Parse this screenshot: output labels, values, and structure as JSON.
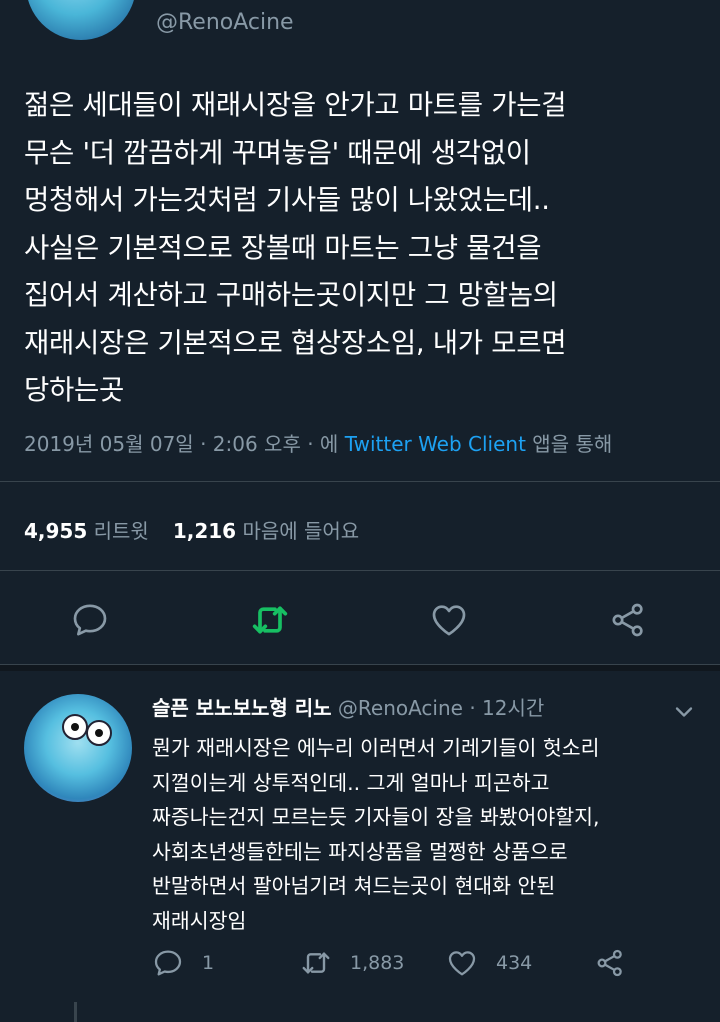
{
  "tweet": {
    "handle": "@RenoAcine",
    "lines": [
      "젊은 세대들이 재래시장을 안가고 마트를 가는걸",
      "무슨 '더 깜끔하게 꾸며놓음' 때문에 생각없이",
      "멍청해서 가는것처럼 기사들 많이 나왔었는데..",
      "사실은 기본적으로 장볼때 마트는 그냥 물건을",
      "집어서 계산하고 구매하는곳이지만 그 망할놈의",
      "재래시장은 기본적으로 협상장소임, 내가 모르면",
      "당하는곳"
    ],
    "meta_prefix": "2019년 05월 07일 · 2:06 오후 · 에 ",
    "source": "Twitter Web Client",
    "meta_suffix": " 앱을 통해",
    "retweets_count": "4,955",
    "retweets_label": "리트윗",
    "likes_count": "1,216",
    "likes_label": "마음에 들어요"
  },
  "reply": {
    "name": "슬픈 보노보노형 리노",
    "handle": "@RenoAcine",
    "time": " · 12시간",
    "lines": [
      "뭔가 재래시장은 에누리 이러면서 기레기들이 헛소리",
      "지껄이는게 상투적인데.. 그게 얼마나 피곤하고",
      "짜증나는건지 모르는듯 기자들이 장을 봐봤어야할지,",
      "사회초년생들한테는 파지상품을 멀쩡한 상품으로",
      "반말하면서 팔아넘기려 쳐드는곳이 현대화 안된",
      "재래시장임"
    ],
    "reply_count": "1",
    "retweet_count": "1,883",
    "like_count": "434"
  },
  "colors": {
    "background": "#15202b",
    "text": "#ffffff",
    "muted": "#8899a6",
    "link": "#1da1f2",
    "retweet_active": "#17bf63"
  }
}
